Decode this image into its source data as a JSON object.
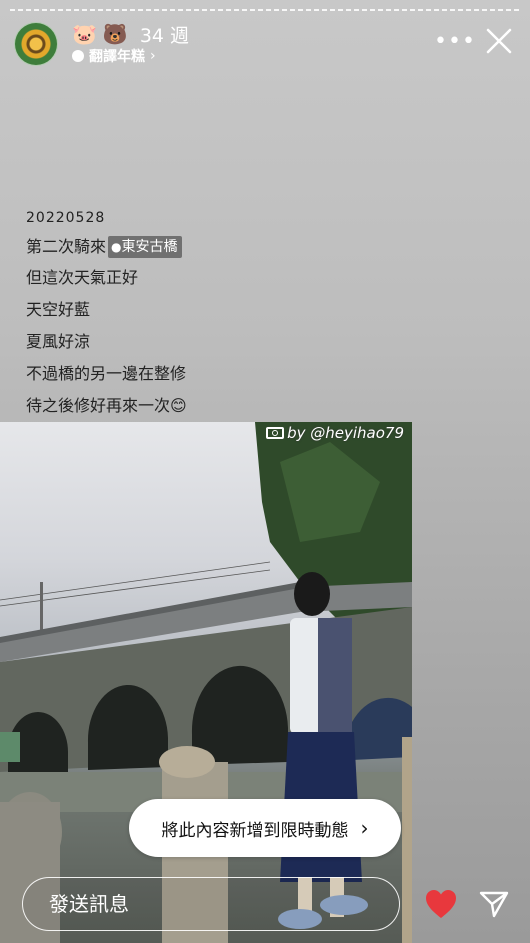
{
  "header": {
    "emojis": [
      "🐷",
      "🐻"
    ],
    "time": "34 週",
    "music_label": "翻譯年糕",
    "more_label": "•••"
  },
  "caption": {
    "date": "20220528",
    "line1": "第二次騎來",
    "location": "東安古橋",
    "line2": "但這次天氣正好",
    "line3": "天空好藍",
    "line4": "夏風好涼",
    "line5": "不過橋的另一邊在整修",
    "line6": "待之後修好再來一次😊"
  },
  "photo": {
    "credit": "by @heyihao79"
  },
  "sticker_prompt": {
    "label": "將此內容新增到限時動態",
    "chevron": "›"
  },
  "message": {
    "placeholder": "發送訊息"
  },
  "icons": {
    "close": "close-icon",
    "heart": "heart-icon",
    "send": "send-icon"
  },
  "colors": {
    "heart": "#e8383d",
    "pill_bg": "#ffffff",
    "location_tag_bg": "#707070"
  }
}
